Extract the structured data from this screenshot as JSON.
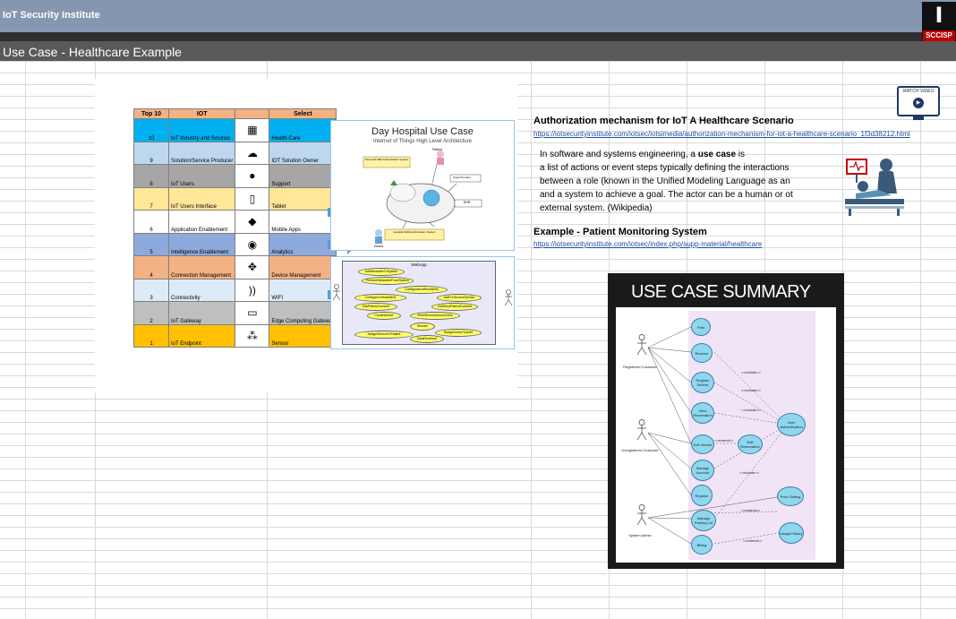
{
  "app": {
    "title": "IoT Security Institute",
    "logo_text": "SCCISP",
    "logo_glyph": "I"
  },
  "sheet": {
    "title": "Use Case - Healthcare Example"
  },
  "top10_table": {
    "headers": [
      "Top 10",
      "IOT",
      "",
      "Select"
    ],
    "rows": [
      {
        "rank": "10",
        "iot": "IoT Industry and Solution",
        "select": "Health Care",
        "color": "#00b0f0",
        "icon": "building-icon"
      },
      {
        "rank": "9",
        "iot": "Solution/Service Producer",
        "select": "IOT Solution Owner",
        "color": "#bdd7ee",
        "icon": "cloud-gear-icon"
      },
      {
        "rank": "8",
        "iot": "IoT Users",
        "select": "Support",
        "color": "#a6a6a6",
        "icon": "user-icon"
      },
      {
        "rank": "7",
        "iot": "IoT Users Interface",
        "select": "Tablet",
        "color": "#ffe699",
        "icon": "devices-icon"
      },
      {
        "rank": "6",
        "iot": "Application Enablement",
        "select": "Mobile Apps",
        "color": "#ffffff",
        "icon": "apps-icon"
      },
      {
        "rank": "5",
        "iot": "Intelligence Enablement",
        "select": "Analytics",
        "color": "#8ea9db",
        "icon": "brain-icon"
      },
      {
        "rank": "4",
        "iot": "Connection Management",
        "select": "Device Management",
        "color": "#f4b183",
        "icon": "network-icon"
      },
      {
        "rank": "3",
        "iot": "Connectivity",
        "select": "WIFI",
        "color": "#ddebf7",
        "icon": "wireless-icon"
      },
      {
        "rank": "2",
        "iot": "IoT Gateway",
        "select": "Edge Computing Gateway",
        "color": "#bfbfbf",
        "icon": "gateway-icon"
      },
      {
        "rank": "1",
        "iot": "IoT Endpoint",
        "select": "Sensor",
        "color": "#ffc000",
        "icon": "sensor-icon"
      }
    ]
  },
  "day_hospital": {
    "title": "Day Hospital Use Case",
    "subtitle": "Internet of Things High Level Architecture",
    "labels": {
      "patient": "Patient",
      "personal": "Personal UMA Authorization System",
      "cloud_provider": "Cloud Provider",
      "ehr": "EHR",
      "hospital": "Hospital UMA Authorization System",
      "doctor": "Doctor"
    }
  },
  "webapp": {
    "title": "WebApp",
    "use_cases": [
      "AddWearableToSystem",
      "RemoveWearableFromSystem",
      "ConfigurationWearAlerts",
      "ConfigureCriticalAlerts",
      "AskForSecondOpinion",
      "AskPatientConsent",
      "AskDenyPatientConsent",
      "CreateAdvice",
      "ShowRecordAdvice/Links",
      "Monitor",
      "AssignServiceToPatient",
      "AssignDeviceToUser",
      "DataReceived"
    ]
  },
  "authorization": {
    "heading": "Authorization mechanism for IoT  A Healthcare Scenario",
    "link": "https://iotsecurityinstitute.com/iotsec/iotsimedia/authorization-mechanism-for-iot-a-healthcare-scenario_1f3d38212.html"
  },
  "definition": {
    "line1_pre": "In software and systems engineering, a ",
    "line1_bold": "use case",
    "line1_post": " is",
    "line2": "a list of actions or event steps typically defining the interactions",
    "line3": " between a role (known in the Unified Modeling Language as an",
    "line4": "and a system to achieve a goal. The actor can be a human or ot",
    "line5": "external system.   (Wikipedia)"
  },
  "example": {
    "heading": "Example - Patient Monitoring System",
    "link": "https://iotsecurityinstitute.com/iotsec/index.php/supp-material/healthcare"
  },
  "watch_video": {
    "label": "WATCH VIDEO"
  },
  "use_case_summary": {
    "title": "USE CASE SUMMARY",
    "actors": [
      "Registered Customer",
      "Unregistered Customer",
      "System Admin"
    ],
    "use_cases": [
      "Park",
      "Reserve",
      "Register Vehicle",
      "View Reservation",
      "Edit Vehicle",
      "Edit Reservation",
      "Manage Account",
      "Register",
      "Manage Parking Lot",
      "Billing",
      "User Authentication",
      "Price Setting",
      "Usage History"
    ],
    "relations": [
      "<<include>>",
      "<<include>>",
      "<<extend>>",
      "<<include>>",
      "<<include>>",
      "<<extend>>",
      "<<extend>>"
    ]
  }
}
